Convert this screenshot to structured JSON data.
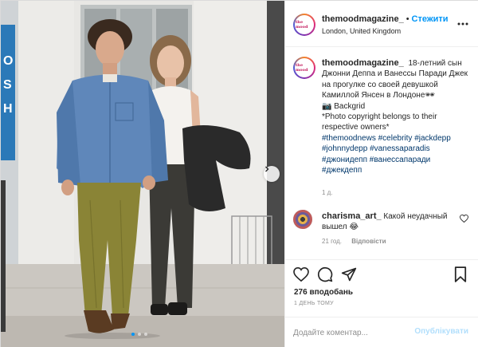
{
  "post": {
    "username": "themoodmagazine_",
    "follow_label": "Стежити",
    "location": "London, United Kingdom",
    "more_icon": "more-horizontal-icon",
    "avatar_text": "the mood"
  },
  "caption": {
    "username": "themoodmagazine_",
    "text": "18-летний сын Джонни Деппа и Ванессы Паради Джек на прогулке со своей девушкой Камиллой Янсен в Лондоне",
    "emoji": "🕶",
    "credit": "📷 Backgrid",
    "copyright": "*Photo copyright belongs to their respective owners*",
    "hashtags": [
      "#themoodnews",
      "#celebrity",
      "#jackdepp",
      "#johnnydepp",
      "#vanessaparadis",
      "#джонидепп",
      "#ванессапаради",
      "#джекдепп"
    ],
    "time": "1 д."
  },
  "comment": {
    "username": "charisma_art_",
    "text": "Какой неудачный вышел",
    "emoji": "😂",
    "time": "21 год.",
    "reply_label": "Відповісти"
  },
  "actions": {
    "likes": "276 вподобань",
    "post_time": "1 ДЕНЬ ТОМУ"
  },
  "add_comment": {
    "placeholder": "Додайте коментар...",
    "publish_label": "Опублікувати"
  },
  "carousel": {
    "slides": 3,
    "active_index": 0
  },
  "colors": {
    "accent": "#0095f6",
    "link": "#00376b",
    "muted": "#8e8e8e",
    "text": "#262626"
  }
}
